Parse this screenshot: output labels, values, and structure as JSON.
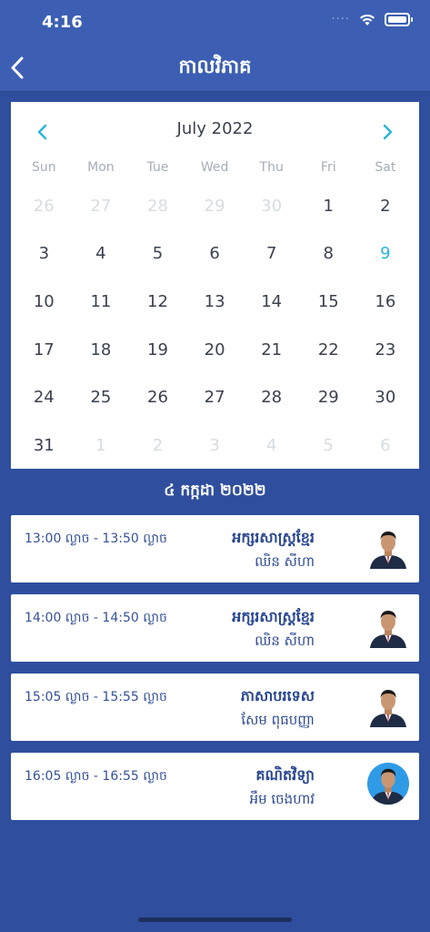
{
  "status_bar": {
    "time": "4:16",
    "signal_dots": "····"
  },
  "header": {
    "title": "កាលវិភាគ"
  },
  "calendar": {
    "month_label": "July 2022",
    "weekdays": [
      "Sun",
      "Mon",
      "Tue",
      "Wed",
      "Thu",
      "Fri",
      "Sat"
    ],
    "days": [
      {
        "label": "26",
        "muted": true
      },
      {
        "label": "27",
        "muted": true
      },
      {
        "label": "28",
        "muted": true
      },
      {
        "label": "29",
        "muted": true
      },
      {
        "label": "30",
        "muted": true
      },
      {
        "label": "1",
        "muted": false
      },
      {
        "label": "2",
        "muted": false
      },
      {
        "label": "3",
        "muted": false
      },
      {
        "label": "4",
        "muted": false
      },
      {
        "label": "5",
        "muted": false
      },
      {
        "label": "6",
        "muted": false
      },
      {
        "label": "7",
        "muted": false
      },
      {
        "label": "8",
        "muted": false
      },
      {
        "label": "9",
        "muted": false,
        "selected": true
      },
      {
        "label": "10",
        "muted": false
      },
      {
        "label": "11",
        "muted": false
      },
      {
        "label": "12",
        "muted": false
      },
      {
        "label": "13",
        "muted": false
      },
      {
        "label": "14",
        "muted": false
      },
      {
        "label": "15",
        "muted": false
      },
      {
        "label": "16",
        "muted": false
      },
      {
        "label": "17",
        "muted": false
      },
      {
        "label": "18",
        "muted": false
      },
      {
        "label": "19",
        "muted": false
      },
      {
        "label": "20",
        "muted": false
      },
      {
        "label": "21",
        "muted": false
      },
      {
        "label": "22",
        "muted": false
      },
      {
        "label": "23",
        "muted": false
      },
      {
        "label": "24",
        "muted": false
      },
      {
        "label": "25",
        "muted": false
      },
      {
        "label": "26",
        "muted": false
      },
      {
        "label": "27",
        "muted": false
      },
      {
        "label": "28",
        "muted": false
      },
      {
        "label": "29",
        "muted": false
      },
      {
        "label": "30",
        "muted": false
      },
      {
        "label": "31",
        "muted": false
      },
      {
        "label": "1",
        "muted": true
      },
      {
        "label": "2",
        "muted": true
      },
      {
        "label": "3",
        "muted": true
      },
      {
        "label": "4",
        "muted": true
      },
      {
        "label": "5",
        "muted": true
      },
      {
        "label": "6",
        "muted": true
      }
    ],
    "accent_color": "#27b4d9"
  },
  "selected_date_label": "៤ កក្កដា ២០២២",
  "sessions": [
    {
      "time": "13:00 ល្ងាច  -  13:50 ល្ងាច",
      "subject": "អក្សរសាស្ត្រខ្មែរ",
      "teacher": "ឈិន សីហា",
      "avatar": "teacher-photo"
    },
    {
      "time": "14:00 ល្ងាច  -  14:50 ល្ងាច",
      "subject": "អក្សរសាស្ត្រខ្មែរ",
      "teacher": "ឈិន សីហា",
      "avatar": "teacher-photo"
    },
    {
      "time": "15:05 ល្ងាច  -  15:55 ល្ងាច",
      "subject": "ភាសាបរទេស",
      "teacher": "សែម ពុធបញ្ញា",
      "avatar": "teacher-photo"
    },
    {
      "time": "16:05 ល្ងាច  -  16:55 ល្ងាច",
      "subject": "គណិតវិទ្យា",
      "teacher": "អឹម ចេងហាវ",
      "avatar": "teacher-photo-circle"
    }
  ],
  "colors": {
    "header": "#3c5fb3",
    "background": "#2f4f9e",
    "text_primary": "#2b4892"
  }
}
